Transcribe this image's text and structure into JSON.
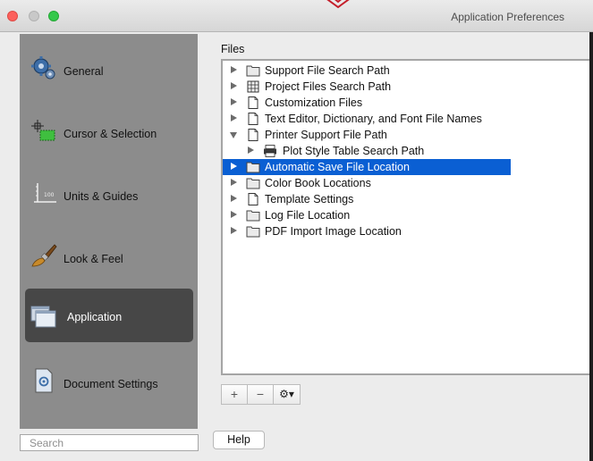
{
  "window": {
    "title": "Application Preferences"
  },
  "sidebar": {
    "items": [
      {
        "label": "General",
        "icon": "gears-icon",
        "selected": false
      },
      {
        "label": "Cursor & Selection",
        "icon": "cursor-crosshair-icon",
        "selected": false
      },
      {
        "label": "Units & Guides",
        "icon": "ruler-icon",
        "selected": false
      },
      {
        "label": "Look & Feel",
        "icon": "paintbrush-icon",
        "selected": false
      },
      {
        "label": "Application",
        "icon": "stacked-windows-icon",
        "selected": true
      },
      {
        "label": "Document Settings",
        "icon": "document-icon",
        "selected": false
      }
    ],
    "search_placeholder": "Search"
  },
  "files": {
    "label": "Files",
    "tree": [
      {
        "label": "Support File Search Path",
        "icon": "folder-icon",
        "level": 0,
        "expanded": false,
        "selected": false
      },
      {
        "label": "Project Files Search Path",
        "icon": "project-grid-icon",
        "level": 0,
        "expanded": false,
        "selected": false
      },
      {
        "label": "Customization Files",
        "icon": "document-icon",
        "level": 0,
        "expanded": false,
        "selected": false
      },
      {
        "label": "Text Editor, Dictionary, and Font File Names",
        "icon": "document-icon",
        "level": 0,
        "expanded": false,
        "selected": false
      },
      {
        "label": "Printer Support File Path",
        "icon": "document-icon",
        "level": 0,
        "expanded": true,
        "selected": false
      },
      {
        "label": "Plot Style Table Search Path",
        "icon": "printer-icon",
        "level": 1,
        "expanded": false,
        "selected": false
      },
      {
        "label": "Automatic Save File Location",
        "icon": "folder-icon",
        "level": 0,
        "expanded": false,
        "selected": true
      },
      {
        "label": "Color Book Locations",
        "icon": "folder-icon",
        "level": 0,
        "expanded": false,
        "selected": false
      },
      {
        "label": "Template Settings",
        "icon": "document-icon",
        "level": 0,
        "expanded": false,
        "selected": false
      },
      {
        "label": "Log File Location",
        "icon": "folder-icon",
        "level": 0,
        "expanded": false,
        "selected": false
      },
      {
        "label": "PDF Import Image Location",
        "icon": "folder-icon",
        "level": 0,
        "expanded": false,
        "selected": false
      }
    ]
  },
  "toolbar": {
    "add_label": "+",
    "remove_label": "−",
    "action_label": "⚙▾"
  },
  "help_label": "Help",
  "colors": {
    "selection": "#0a5fd3",
    "sidebar": "#8c8c8c",
    "sidebar_selected": "#474747"
  }
}
